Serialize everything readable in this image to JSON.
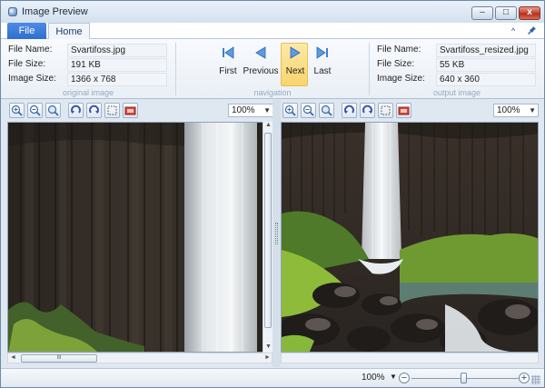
{
  "window": {
    "title": "Image Preview",
    "min_label": "‒",
    "max_label": "□",
    "close_label": "x"
  },
  "menu": {
    "file": "File",
    "home": "Home"
  },
  "original": {
    "file_name_label": "File Name:",
    "file_name": "Svartifoss.jpg",
    "file_size_label": "File Size:",
    "file_size": "191 KB",
    "image_size_label": "Image Size:",
    "image_size": "1366 x 768",
    "caption": "original image"
  },
  "navigation": {
    "first": "First",
    "previous": "Previous",
    "next": "Next",
    "last": "Last",
    "caption": "navigation"
  },
  "output": {
    "file_name_label": "File Name:",
    "file_name": "Svartifoss_resized.jpg",
    "file_size_label": "File Size:",
    "file_size": "55 KB",
    "image_size_label": "Image Size:",
    "image_size": "640 x 360",
    "caption": "output image"
  },
  "left_pane": {
    "zoom": "100%"
  },
  "right_pane": {
    "zoom": "100%"
  },
  "status": {
    "zoom": "100%",
    "zoom_minus": "−",
    "zoom_plus": "+",
    "zoom_slider_fraction": 0.5
  },
  "scroll_arrows": {
    "up": "▲",
    "down": "▼",
    "left": "◄",
    "right": "►",
    "thumb": "III"
  },
  "colors": {
    "accent": "#2f6fcd",
    "highlight": "#f8d46b"
  },
  "icons": [
    "app-icon",
    "pin-icon",
    "first-icon",
    "previous-icon",
    "next-icon",
    "last-icon",
    "zoom-in-icon",
    "zoom-out-icon",
    "zoom-fit-icon",
    "rotate-left-icon",
    "rotate-right-icon",
    "crop-icon",
    "flip-icon"
  ]
}
